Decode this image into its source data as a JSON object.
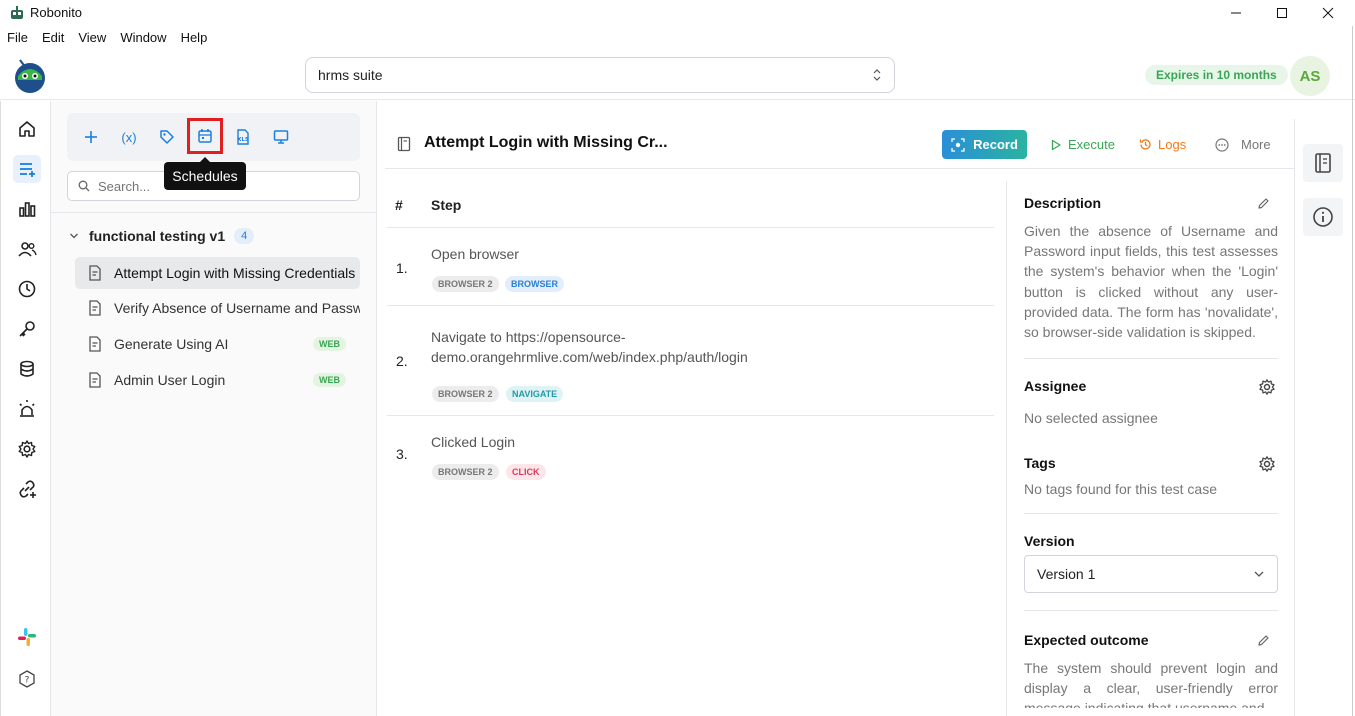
{
  "window": {
    "title": "Robonito"
  },
  "menu": [
    "File",
    "Edit",
    "View",
    "Window",
    "Help"
  ],
  "header": {
    "suite": "hrms suite",
    "expires": "Expires in 10 months",
    "avatar": "AS"
  },
  "toolbar": {
    "variables_label": "(x)",
    "tooltip": "Schedules"
  },
  "search": {
    "placeholder": "Search..."
  },
  "tree": {
    "folder": "functional testing v1",
    "count": "4",
    "items": [
      {
        "label": "Attempt Login with Missing Credentials (",
        "badge": ""
      },
      {
        "label": "Verify Absence of Username and Password",
        "badge": ""
      },
      {
        "label": "Generate Using AI",
        "badge": "WEB"
      },
      {
        "label": "Admin User Login",
        "badge": "WEB"
      }
    ]
  },
  "main": {
    "title": "Attempt Login with Missing Cr...",
    "record": "Record",
    "execute": "Execute",
    "logs": "Logs",
    "more": "More",
    "col_num": "#",
    "col_step": "Step",
    "steps": [
      {
        "num": "1.",
        "title": "Open browser",
        "tags": [
          "BROWSER 2",
          "BROWSER"
        ]
      },
      {
        "num": "2.",
        "title": "Navigate to https://opensource-demo.orangehrmlive.com/web/index.php/auth/login",
        "tags": [
          "BROWSER 2",
          "NAVIGATE"
        ]
      },
      {
        "num": "3.",
        "title": "Clicked Login",
        "tags": [
          "BROWSER 2",
          "CLICK"
        ]
      }
    ]
  },
  "side": {
    "description_title": "Description",
    "description": "Given the absence of Username and Password input fields, this test assesses the system's behavior when the 'Login' button is clicked without any user-provided data. The form has 'novalidate', so browser-side validation is skipped.",
    "assignee_title": "Assignee",
    "assignee": "No selected assignee",
    "tags_title": "Tags",
    "tags": "No tags found for this test case",
    "version_title": "Version",
    "version": "Version 1",
    "outcome_title": "Expected outcome",
    "outcome": "The system should prevent login and display a clear, user-friendly error message indicating that username and"
  },
  "colors": {
    "accent": "#1a7fe0",
    "execute": "#3aa655",
    "logs": "#f07a1a",
    "badge_green": "#3aa655"
  }
}
